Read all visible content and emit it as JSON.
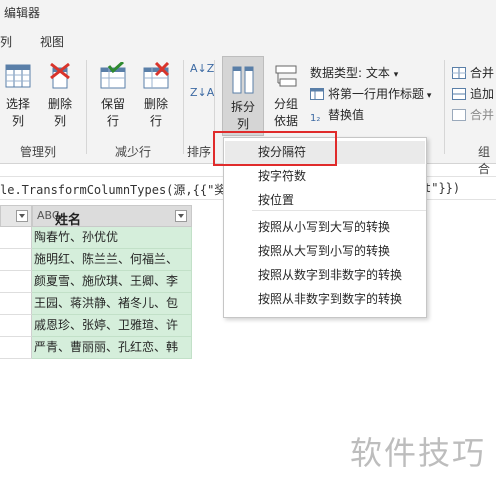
{
  "window": {
    "title": "编辑器"
  },
  "menubar": {
    "items": [
      "列",
      "视图"
    ]
  },
  "ribbon": {
    "manage_columns": {
      "group_label": "管理列",
      "select_columns": "选择\n列",
      "remove_columns": "删除\n列"
    },
    "reduce_rows": {
      "group_label": "减少行",
      "keep_rows": "保留\n行",
      "remove_rows": "删除\n行"
    },
    "sort": {
      "group_label": "排序",
      "asc": "A↓Z",
      "desc": "Z↓A"
    },
    "transform": {
      "split_column": "拆分\n列",
      "group_by": "分组\n依据",
      "data_type": "数据类型: 文本",
      "first_row_header": "将第一行用作标题",
      "replace_values": "替换值"
    },
    "combine": {
      "group_label": "组合",
      "merge": "合并",
      "append": "追加",
      "merge2": "合并"
    }
  },
  "formula": {
    "text": "le.TransformColumnTypes(源,{{\"奖项",
    "tail": "t\"}})"
  },
  "grid": {
    "column_type": "ABC",
    "column_name": "姓名",
    "rows": [
      "陶春竹、孙优优",
      "施明红、陈兰兰、何福兰、",
      "颜夏雪、施欣琪、王卿、李",
      "王园、蒋洪静、褚冬儿、包",
      "戚恩珍、张婷、卫雅瑄、许",
      "严青、曹丽丽、孔红恋、韩"
    ]
  },
  "split_menu": {
    "items": [
      "按分隔符",
      "按字符数",
      "按位置",
      "按照从小写到大写的转换",
      "按照从大写到小写的转换",
      "按照从数字到非数字的转换",
      "按照从非数字到数字的转换"
    ]
  },
  "watermark": {
    "text": "软件技巧"
  }
}
